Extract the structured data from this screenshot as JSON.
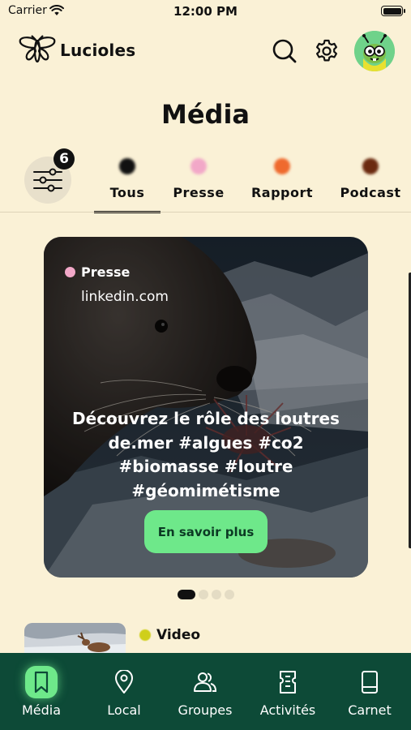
{
  "status_bar": {
    "carrier": "Carrier",
    "time": "12:00 PM"
  },
  "header": {
    "app_name": "Lucioles"
  },
  "page_title": "Média",
  "filter": {
    "count": "6"
  },
  "tabs": [
    {
      "label": "Tous",
      "color": "#111111",
      "active": true
    },
    {
      "label": "Presse",
      "color": "#f2a8c8",
      "active": false
    },
    {
      "label": "Rapport",
      "color": "#ef6a2e",
      "active": false
    },
    {
      "label": "Podcast",
      "color": "#6b2a10",
      "active": false
    }
  ],
  "card": {
    "category": "Presse",
    "category_color": "#f2a8c8",
    "source": "linkedin.com",
    "headline": "Découvrez le rôle des loutres de.mer #algues #co2 #biomasse #loutre #géomimétisme",
    "cta_label": "En savoir plus"
  },
  "pager": {
    "total": 4,
    "current": 1
  },
  "next_item": {
    "category": "Video",
    "category_color": "#cfcf1a"
  },
  "nav": [
    {
      "label": "Média",
      "icon": "bookmark-icon",
      "active": true
    },
    {
      "label": "Local",
      "icon": "map-pin-icon",
      "active": false
    },
    {
      "label": "Groupes",
      "icon": "users-icon",
      "active": false
    },
    {
      "label": "Activités",
      "icon": "ticket-icon",
      "active": false
    },
    {
      "label": "Carnet",
      "icon": "notebook-icon",
      "active": false
    }
  ],
  "colors": {
    "background": "#faf1d6",
    "nav_background": "#0d4a37",
    "accent": "#6ee88a"
  }
}
